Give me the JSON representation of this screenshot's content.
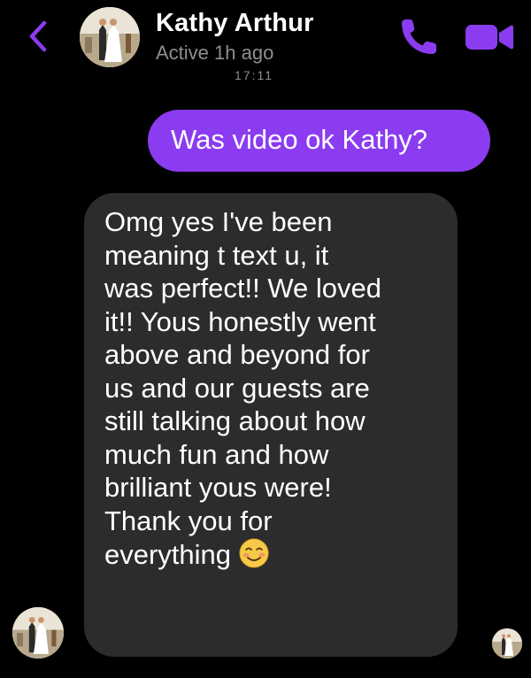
{
  "header": {
    "contact_name": "Kathy Arthur",
    "status": "Active 1h ago",
    "time_peek": "17:11",
    "back_icon": "chevron-left-icon",
    "call_icon": "phone-icon",
    "video_icon": "video-camera-icon"
  },
  "messages": [
    {
      "direction": "sent",
      "text": "Was video ok Kathy?"
    },
    {
      "direction": "received",
      "lines": [
        "Omg yes I've been",
        "meaning t text u, it",
        "was perfect!! We loved",
        "it!! Yous honestly went",
        "above and beyond for",
        "us and our guests are",
        "still talking about how",
        "much fun and how",
        "brilliant yous were!",
        "Thank you for",
        "everything"
      ],
      "emoji": "smiling-face-icon"
    }
  ],
  "colors": {
    "accent": "#8b3cf0",
    "sent_bubble": "#8b3cf0",
    "received_bubble": "#2c2c2e",
    "background": "#000000",
    "status_text": "#8e8e93"
  }
}
